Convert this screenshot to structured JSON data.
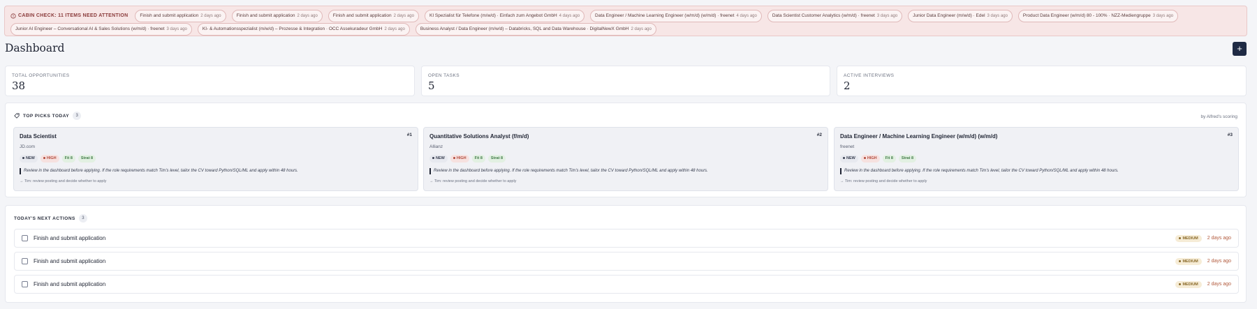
{
  "alert": {
    "title": "CABIN CHECK: 11 ITEMS NEED ATTENTION",
    "items": [
      {
        "label": "Finish and submit application",
        "ago": "2 days ago"
      },
      {
        "label": "Finish and submit application",
        "ago": "2 days ago"
      },
      {
        "label": "Finish and submit application",
        "ago": "2 days ago"
      },
      {
        "label": "KI Spezialist für Telefone (m/w/d) · Einfach zum Angebot GmbH",
        "ago": "4 days ago"
      },
      {
        "label": "Data Engineer / Machine Learning Engineer (w/m/d) (w/m/d) · freenet",
        "ago": "4 days ago"
      },
      {
        "label": "Data Scientist Customer Analytics (w/m/d) · freenet",
        "ago": "3 days ago"
      },
      {
        "label": "Junior Data Engineer (m/w/d) · Edel",
        "ago": "3 days ago"
      },
      {
        "label": "Product Data Engineer (w/m/d) 80 - 100% · NZZ-Mediengruppe",
        "ago": "3 days ago"
      },
      {
        "label": "Junior AI Engineer – Conversational AI & Sales Solutions (w/m/d) · freenet",
        "ago": "3 days ago"
      },
      {
        "label": "KI- & Automationsspezialist (m/w/d) – Prozesse & Integration · OCC Assekuradeur GmbH",
        "ago": "2 days ago"
      },
      {
        "label": "Business Analyst / Data Engineer (m/w/d) – Databricks, SQL and Data Warehouse · DigitalNewX GmbH",
        "ago": "2 days ago"
      }
    ]
  },
  "page": {
    "title": "Dashboard",
    "add_label": "+"
  },
  "stats": [
    {
      "label": "TOTAL OPPORTUNITIES",
      "value": "38"
    },
    {
      "label": "OPEN TASKS",
      "value": "5"
    },
    {
      "label": "ACTIVE INTERVIEWS",
      "value": "2"
    }
  ],
  "top_picks": {
    "title": "TOP PICKS TODAY",
    "count": "3",
    "scoring": "by Alfred's scoring",
    "cards": [
      {
        "rank": "#1",
        "title": "Data Scientist",
        "company": "JD.com",
        "status": "NEW",
        "priority": "HIGH",
        "fit": "Fit 8",
        "strat": "Strat 8",
        "note": "Review in the dashboard before applying. If the role requirements match Tim's level, tailor the CV toward Python/SQL/ML and apply within 48 hours.",
        "action": "→ Tim: review posting and decide whether to apply"
      },
      {
        "rank": "#2",
        "title": "Quantitative Solutions Analyst (f/m/d)",
        "company": "Allianz",
        "status": "NEW",
        "priority": "HIGH",
        "fit": "Fit 8",
        "strat": "Strat 8",
        "note": "Review in the dashboard before applying. If the role requirements match Tim's level, tailor the CV toward Python/SQL/ML and apply within 48 hours.",
        "action": "→ Tim: review posting and decide whether to apply"
      },
      {
        "rank": "#3",
        "title": "Data Engineer / Machine Learning Engineer (w/m/d) (w/m/d)",
        "company": "freenet",
        "status": "NEW",
        "priority": "HIGH",
        "fit": "Fit 8",
        "strat": "Strat 8",
        "note": "Review in the dashboard before applying. If the role requirements match Tim's level, tailor the CV toward Python/SQL/ML and apply within 48 hours.",
        "action": "→ Tim: review posting and decide whether to apply"
      }
    ]
  },
  "next_actions": {
    "title": "TODAY'S NEXT ACTIONS",
    "count": "3",
    "items": [
      {
        "label": "Finish and submit application",
        "priority": "MEDIUM",
        "due": "2 days ago"
      },
      {
        "label": "Finish and submit application",
        "priority": "MEDIUM",
        "due": "2 days ago"
      },
      {
        "label": "Finish and submit application",
        "priority": "MEDIUM",
        "due": "2 days ago"
      }
    ]
  },
  "colors": {
    "accent": "#1f2a44",
    "alert_bg": "#f7e6e6",
    "high": "#b34a3c",
    "due": "#b25a3c"
  }
}
